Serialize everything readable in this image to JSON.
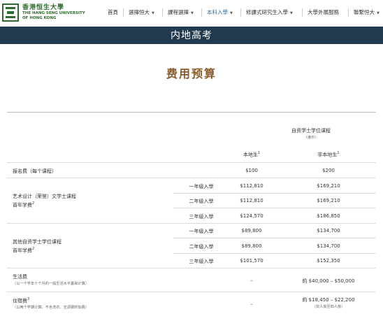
{
  "logo": {
    "cn": "香港恒生大學",
    "en1": "THE HANG SENG UNIVERSITY",
    "en2": "OF HONG KONG"
  },
  "nav": [
    {
      "label": "首頁",
      "chevron": false
    },
    {
      "label": "選擇恒大",
      "chevron": true
    },
    {
      "label": "課程選擇",
      "chevron": true
    },
    {
      "label": "本科入學",
      "chevron": true,
      "active": true
    },
    {
      "label": "修課式研究生入學",
      "chevron": true
    },
    {
      "label": "大學外展服務",
      "chevron": false
    },
    {
      "label": "聯繫恒大",
      "chevron": true
    }
  ],
  "banner_title": "内地高考",
  "page_title": "费用预算",
  "table": {
    "group_header": "自资学士学位课程",
    "group_sub": "（港币）",
    "col_local": "本地生",
    "col_nonlocal": "非本地生",
    "sup1": "1",
    "rows": {
      "application": {
        "label": "报名费（每个课程）",
        "local": "$100",
        "nonlocal": "$200"
      },
      "arts": {
        "label_line1": "艺术设计（荣誉）文学士课程",
        "label_line2": "首年学费",
        "sup": "2",
        "sub": [
          {
            "intake": "一年級入學",
            "local": "$112,810",
            "nonlocal": "$169,210"
          },
          {
            "intake": "二年級入學",
            "local": "$112,810",
            "nonlocal": "$169,210"
          },
          {
            "intake": "三年級入學",
            "local": "$124,570",
            "nonlocal": "$186,850"
          }
        ]
      },
      "other": {
        "label_line1": "其他自资学士学位课程",
        "label_line2": "首年学费",
        "sup": "2",
        "sub": [
          {
            "intake": "一年級入學",
            "local": "$89,800",
            "nonlocal": "$134,700"
          },
          {
            "intake": "二年級入學",
            "local": "$89,800",
            "nonlocal": "$134,700"
          },
          {
            "intake": "三年級入學",
            "local": "$101,570",
            "nonlocal": "$152,350"
          }
        ]
      },
      "living": {
        "label": "生活费",
        "note": "（以一个学年十个月的一般生活水平基础计算）",
        "local": "–",
        "nonlocal": "約 $40,000 – $50,000"
      },
      "housing": {
        "label": "住宿费",
        "sup": "3",
        "note": "（以两个学期计算，不含洗衣、空调费附加费）",
        "local": "–",
        "nonlocal": "約 $18,450 – $22,200",
        "nonlocal_note": "（双人房至四人房）"
      }
    }
  }
}
